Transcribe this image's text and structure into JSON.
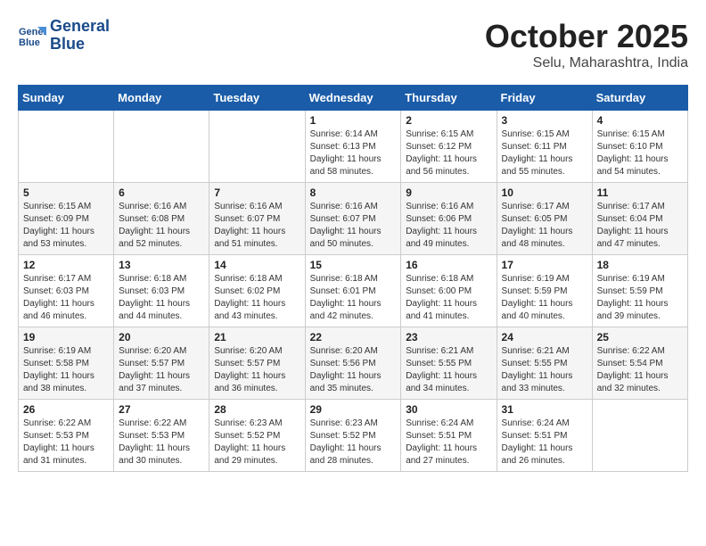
{
  "header": {
    "logo_line1": "General",
    "logo_line2": "Blue",
    "month": "October 2025",
    "location": "Selu, Maharashtra, India"
  },
  "days_of_week": [
    "Sunday",
    "Monday",
    "Tuesday",
    "Wednesday",
    "Thursday",
    "Friday",
    "Saturday"
  ],
  "weeks": [
    [
      {
        "day": "",
        "sunrise": "",
        "sunset": "",
        "daylight": ""
      },
      {
        "day": "",
        "sunrise": "",
        "sunset": "",
        "daylight": ""
      },
      {
        "day": "",
        "sunrise": "",
        "sunset": "",
        "daylight": ""
      },
      {
        "day": "1",
        "sunrise": "Sunrise: 6:14 AM",
        "sunset": "Sunset: 6:13 PM",
        "daylight": "Daylight: 11 hours and 58 minutes."
      },
      {
        "day": "2",
        "sunrise": "Sunrise: 6:15 AM",
        "sunset": "Sunset: 6:12 PM",
        "daylight": "Daylight: 11 hours and 56 minutes."
      },
      {
        "day": "3",
        "sunrise": "Sunrise: 6:15 AM",
        "sunset": "Sunset: 6:11 PM",
        "daylight": "Daylight: 11 hours and 55 minutes."
      },
      {
        "day": "4",
        "sunrise": "Sunrise: 6:15 AM",
        "sunset": "Sunset: 6:10 PM",
        "daylight": "Daylight: 11 hours and 54 minutes."
      }
    ],
    [
      {
        "day": "5",
        "sunrise": "Sunrise: 6:15 AM",
        "sunset": "Sunset: 6:09 PM",
        "daylight": "Daylight: 11 hours and 53 minutes."
      },
      {
        "day": "6",
        "sunrise": "Sunrise: 6:16 AM",
        "sunset": "Sunset: 6:08 PM",
        "daylight": "Daylight: 11 hours and 52 minutes."
      },
      {
        "day": "7",
        "sunrise": "Sunrise: 6:16 AM",
        "sunset": "Sunset: 6:07 PM",
        "daylight": "Daylight: 11 hours and 51 minutes."
      },
      {
        "day": "8",
        "sunrise": "Sunrise: 6:16 AM",
        "sunset": "Sunset: 6:07 PM",
        "daylight": "Daylight: 11 hours and 50 minutes."
      },
      {
        "day": "9",
        "sunrise": "Sunrise: 6:16 AM",
        "sunset": "Sunset: 6:06 PM",
        "daylight": "Daylight: 11 hours and 49 minutes."
      },
      {
        "day": "10",
        "sunrise": "Sunrise: 6:17 AM",
        "sunset": "Sunset: 6:05 PM",
        "daylight": "Daylight: 11 hours and 48 minutes."
      },
      {
        "day": "11",
        "sunrise": "Sunrise: 6:17 AM",
        "sunset": "Sunset: 6:04 PM",
        "daylight": "Daylight: 11 hours and 47 minutes."
      }
    ],
    [
      {
        "day": "12",
        "sunrise": "Sunrise: 6:17 AM",
        "sunset": "Sunset: 6:03 PM",
        "daylight": "Daylight: 11 hours and 46 minutes."
      },
      {
        "day": "13",
        "sunrise": "Sunrise: 6:18 AM",
        "sunset": "Sunset: 6:03 PM",
        "daylight": "Daylight: 11 hours and 44 minutes."
      },
      {
        "day": "14",
        "sunrise": "Sunrise: 6:18 AM",
        "sunset": "Sunset: 6:02 PM",
        "daylight": "Daylight: 11 hours and 43 minutes."
      },
      {
        "day": "15",
        "sunrise": "Sunrise: 6:18 AM",
        "sunset": "Sunset: 6:01 PM",
        "daylight": "Daylight: 11 hours and 42 minutes."
      },
      {
        "day": "16",
        "sunrise": "Sunrise: 6:18 AM",
        "sunset": "Sunset: 6:00 PM",
        "daylight": "Daylight: 11 hours and 41 minutes."
      },
      {
        "day": "17",
        "sunrise": "Sunrise: 6:19 AM",
        "sunset": "Sunset: 5:59 PM",
        "daylight": "Daylight: 11 hours and 40 minutes."
      },
      {
        "day": "18",
        "sunrise": "Sunrise: 6:19 AM",
        "sunset": "Sunset: 5:59 PM",
        "daylight": "Daylight: 11 hours and 39 minutes."
      }
    ],
    [
      {
        "day": "19",
        "sunrise": "Sunrise: 6:19 AM",
        "sunset": "Sunset: 5:58 PM",
        "daylight": "Daylight: 11 hours and 38 minutes."
      },
      {
        "day": "20",
        "sunrise": "Sunrise: 6:20 AM",
        "sunset": "Sunset: 5:57 PM",
        "daylight": "Daylight: 11 hours and 37 minutes."
      },
      {
        "day": "21",
        "sunrise": "Sunrise: 6:20 AM",
        "sunset": "Sunset: 5:57 PM",
        "daylight": "Daylight: 11 hours and 36 minutes."
      },
      {
        "day": "22",
        "sunrise": "Sunrise: 6:20 AM",
        "sunset": "Sunset: 5:56 PM",
        "daylight": "Daylight: 11 hours and 35 minutes."
      },
      {
        "day": "23",
        "sunrise": "Sunrise: 6:21 AM",
        "sunset": "Sunset: 5:55 PM",
        "daylight": "Daylight: 11 hours and 34 minutes."
      },
      {
        "day": "24",
        "sunrise": "Sunrise: 6:21 AM",
        "sunset": "Sunset: 5:55 PM",
        "daylight": "Daylight: 11 hours and 33 minutes."
      },
      {
        "day": "25",
        "sunrise": "Sunrise: 6:22 AM",
        "sunset": "Sunset: 5:54 PM",
        "daylight": "Daylight: 11 hours and 32 minutes."
      }
    ],
    [
      {
        "day": "26",
        "sunrise": "Sunrise: 6:22 AM",
        "sunset": "Sunset: 5:53 PM",
        "daylight": "Daylight: 11 hours and 31 minutes."
      },
      {
        "day": "27",
        "sunrise": "Sunrise: 6:22 AM",
        "sunset": "Sunset: 5:53 PM",
        "daylight": "Daylight: 11 hours and 30 minutes."
      },
      {
        "day": "28",
        "sunrise": "Sunrise: 6:23 AM",
        "sunset": "Sunset: 5:52 PM",
        "daylight": "Daylight: 11 hours and 29 minutes."
      },
      {
        "day": "29",
        "sunrise": "Sunrise: 6:23 AM",
        "sunset": "Sunset: 5:52 PM",
        "daylight": "Daylight: 11 hours and 28 minutes."
      },
      {
        "day": "30",
        "sunrise": "Sunrise: 6:24 AM",
        "sunset": "Sunset: 5:51 PM",
        "daylight": "Daylight: 11 hours and 27 minutes."
      },
      {
        "day": "31",
        "sunrise": "Sunrise: 6:24 AM",
        "sunset": "Sunset: 5:51 PM",
        "daylight": "Daylight: 11 hours and 26 minutes."
      },
      {
        "day": "",
        "sunrise": "",
        "sunset": "",
        "daylight": ""
      }
    ]
  ]
}
